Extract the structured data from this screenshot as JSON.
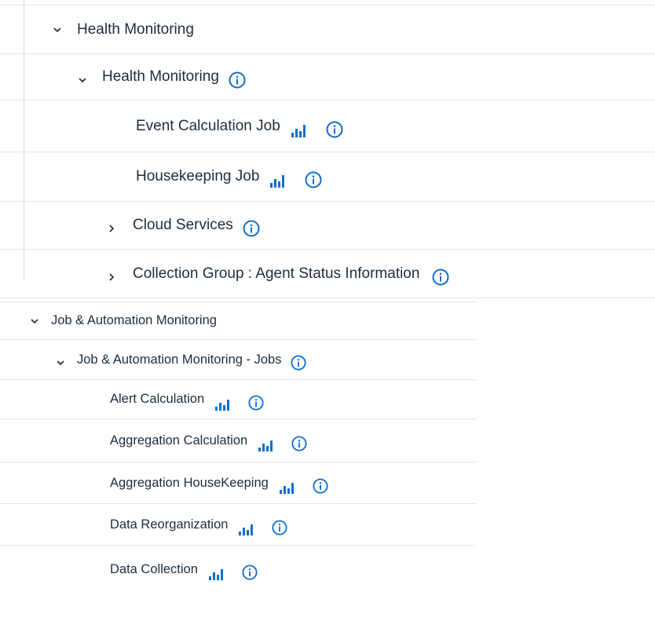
{
  "colors": {
    "accent": "#0a6ed1",
    "text": "#1d2d3e",
    "divider": "#e4e4e4"
  },
  "health_section": {
    "root": {
      "label": "Health Monitoring",
      "icon": "chevron-down-icon"
    },
    "group": {
      "label": "Health Monitoring",
      "icon": "chevron-down-icon"
    },
    "jobs": [
      {
        "label": "Event Calculation Job"
      },
      {
        "label": "Housekeeping Job"
      }
    ],
    "collapsed_groups": [
      {
        "label": "Cloud Services",
        "icon": "chevron-right-icon"
      },
      {
        "label": "Collection Group : Agent Status Information",
        "icon": "chevron-right-icon"
      }
    ]
  },
  "jam_section": {
    "root": {
      "label": "Job & Automation Monitoring",
      "icon": "chevron-down-icon"
    },
    "group": {
      "label": "Job & Automation Monitoring - Jobs",
      "icon": "chevron-down-icon"
    },
    "jobs": [
      {
        "label": "Alert Calculation"
      },
      {
        "label": "Aggregation Calculation"
      },
      {
        "label": "Aggregation HouseKeeping"
      },
      {
        "label": "Data Reorganization"
      },
      {
        "label": "Data Collection"
      }
    ]
  }
}
